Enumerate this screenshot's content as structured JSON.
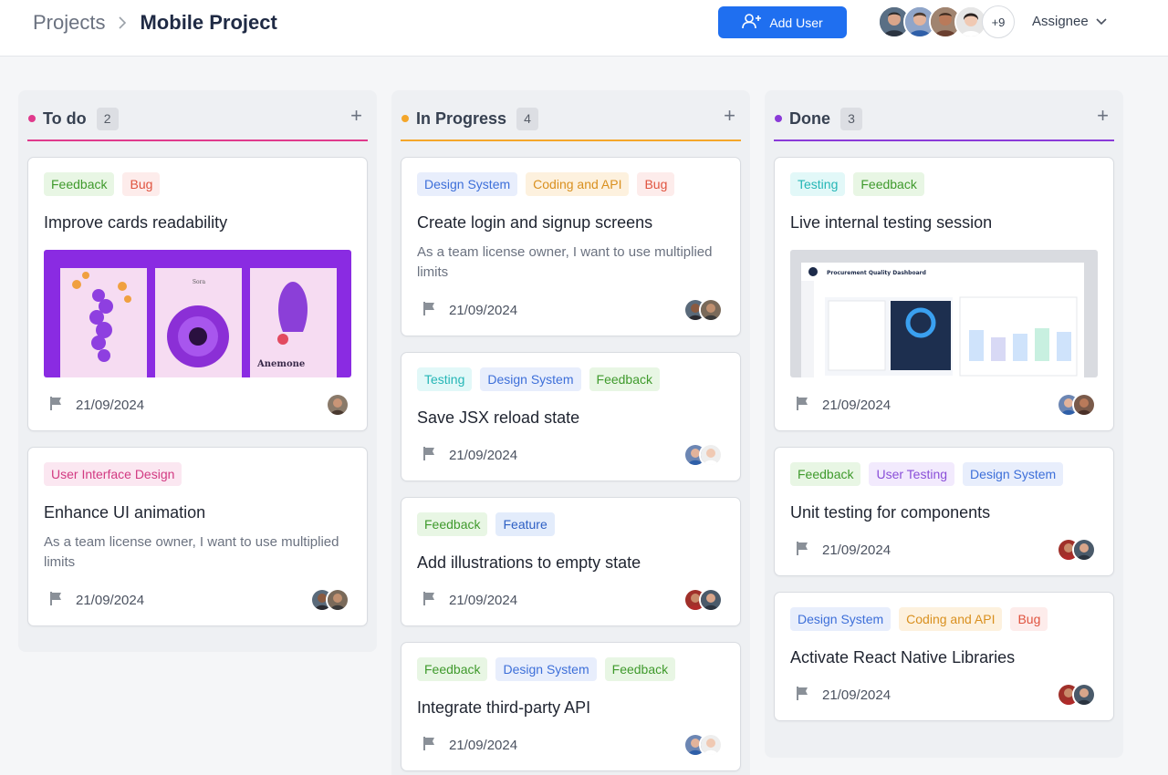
{
  "breadcrumb": {
    "root": "Projects",
    "current": "Mobile Project"
  },
  "header": {
    "add_user_label": "Add User",
    "more_count": "+9",
    "assignee_label": "Assignee"
  },
  "colors": {
    "todo": "#e03a8c",
    "in_progress": "#f4a62a",
    "done": "#8a3ad8",
    "primary": "#1f6ff0"
  },
  "columns": [
    {
      "title": "To do",
      "count": "2",
      "cards": [
        {
          "tags": [
            "Feedback",
            "Bug"
          ],
          "title": "Improve cards readability",
          "date": "21/09/2024",
          "thumb": {
            "caption": "Anemone"
          }
        },
        {
          "tags": [
            "User Interface Design"
          ],
          "title": "Enhance UI animation",
          "desc": "As a team license owner, I want to use multiplied limits",
          "date": "21/09/2024"
        }
      ]
    },
    {
      "title": "In Progress",
      "count": "4",
      "cards": [
        {
          "tags": [
            "Design System",
            "Coding and API",
            "Bug"
          ],
          "title": "Create login and signup screens",
          "desc": "As a team license owner, I want to use multiplied limits",
          "date": "21/09/2024"
        },
        {
          "tags": [
            "Testing",
            "Design System",
            "Feedback"
          ],
          "title": "Save JSX reload state",
          "date": "21/09/2024"
        },
        {
          "tags": [
            "Feedback",
            "Feature"
          ],
          "title": "Add illustrations to empty state",
          "date": "21/09/2024"
        },
        {
          "tags": [
            "Feedback",
            "Design System",
            "Feedback"
          ],
          "title": "Integrate third-party API",
          "date": "21/09/2024"
        }
      ]
    },
    {
      "title": "Done",
      "count": "3",
      "cards": [
        {
          "tags": [
            "Testing",
            "Feedback"
          ],
          "title": "Live internal testing session",
          "date": "21/09/2024",
          "thumb": {
            "caption": "Procurement Quality Dashboard"
          }
        },
        {
          "tags": [
            "Feedback",
            "User Testing",
            "Design System"
          ],
          "title": "Unit testing for components",
          "date": "21/09/2024"
        },
        {
          "tags": [
            "Design System",
            "Coding and API",
            "Bug"
          ],
          "title": "Activate React Native Libraries",
          "date": "21/09/2024"
        }
      ]
    }
  ]
}
